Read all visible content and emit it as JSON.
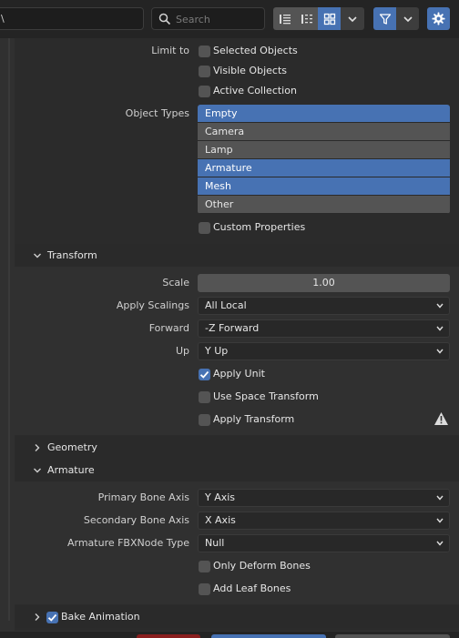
{
  "toolbar": {
    "search_placeholder": "Search",
    "left_field_text": "\\"
  },
  "include": {
    "limit_to_label": "Limit to",
    "selected_objects": "Selected Objects",
    "visible_objects": "Visible Objects",
    "active_collection": "Active Collection",
    "object_types_label": "Object Types",
    "object_types": [
      {
        "label": "Empty",
        "selected": true
      },
      {
        "label": "Camera",
        "selected": false
      },
      {
        "label": "Lamp",
        "selected": false
      },
      {
        "label": "Armature",
        "selected": true
      },
      {
        "label": "Mesh",
        "selected": true
      },
      {
        "label": "Other",
        "selected": false
      }
    ],
    "custom_properties": "Custom Properties"
  },
  "transform": {
    "title": "Transform",
    "scale_label": "Scale",
    "scale_value": "1.00",
    "apply_scalings_label": "Apply Scalings",
    "apply_scalings_value": "All Local",
    "forward_label": "Forward",
    "forward_value": "-Z Forward",
    "up_label": "Up",
    "up_value": "Y Up",
    "apply_unit": "Apply Unit",
    "apply_unit_checked": true,
    "use_space_transform": "Use Space Transform",
    "apply_transform": "Apply Transform"
  },
  "geometry": {
    "title": "Geometry"
  },
  "armature": {
    "title": "Armature",
    "primary_label": "Primary Bone Axis",
    "primary_value": "Y Axis",
    "secondary_label": "Secondary Bone Axis",
    "secondary_value": "X Axis",
    "node_type_label": "Armature FBXNode Type",
    "node_type_value": "Null",
    "only_deform": "Only Deform Bones",
    "add_leaf": "Add Leaf Bones"
  },
  "bake": {
    "title": "Bake Animation",
    "checked": true
  },
  "colors": {
    "accent": "#4772b3",
    "panel": "#2b2b2b",
    "field": "#545454"
  }
}
